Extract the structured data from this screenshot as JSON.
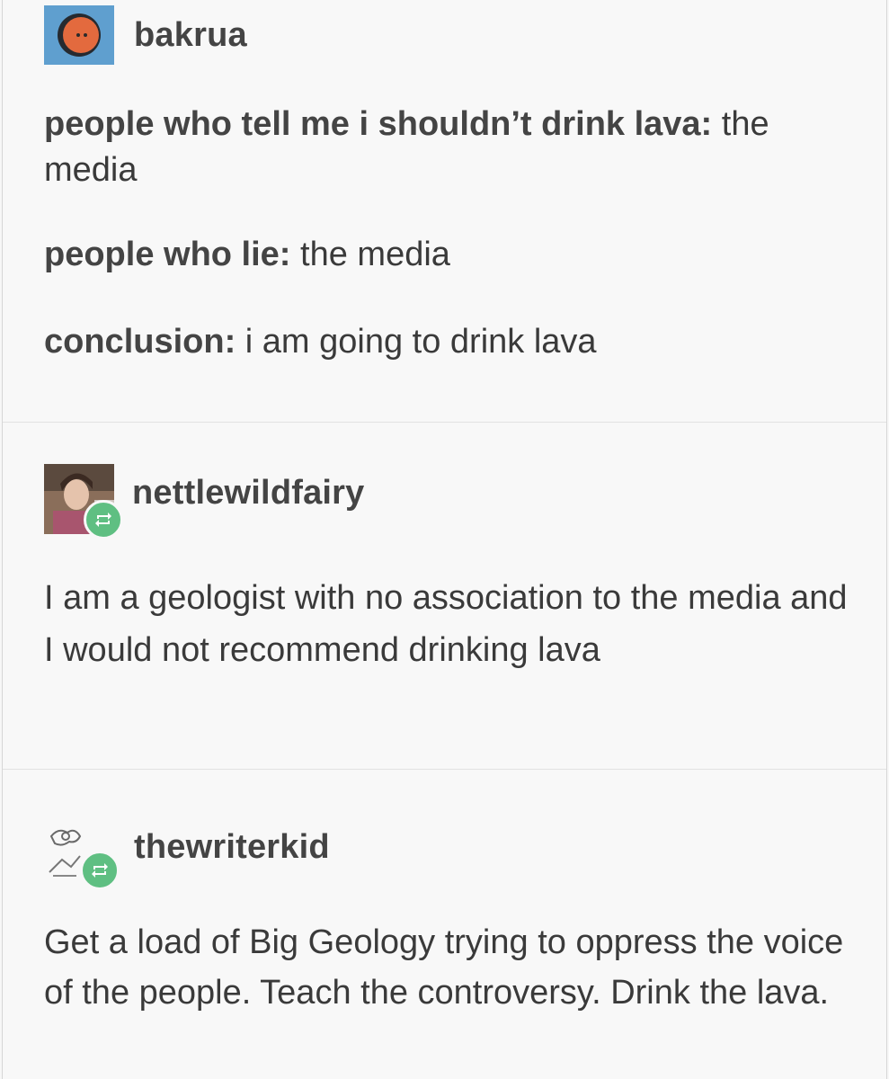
{
  "posts": [
    {
      "username": "bakrua",
      "avatar_icon": "orange-face-avatar-icon",
      "lines": [
        {
          "bold": "people who tell me i shouldn’t drink lava:",
          "text": " the media"
        },
        {
          "bold": "people who lie:",
          "text": " the media"
        },
        {
          "bold": "conclusion:",
          "text": " i am going to drink lava"
        }
      ]
    },
    {
      "username": "nettlewildfairy",
      "avatar_icon": "person-photo-avatar-icon",
      "badge_icon": "reblog-icon",
      "text": "I am a geologist with no association to the media and I would not recommend drinking lava"
    },
    {
      "username": "thewriterkid",
      "avatar_icon": "sketch-drawing-avatar-icon",
      "badge_icon": "reblog-icon",
      "text": "Get a load of Big Geology trying to oppress the voice of the people. Teach the controversy. Drink the lava."
    }
  ],
  "colors": {
    "background": "#f8f8f8",
    "text": "#3a3a3a",
    "reblog_badge": "#5fbf82",
    "avatar_bg": "#5f9fcf",
    "avatar_face": "#e36a3e"
  }
}
